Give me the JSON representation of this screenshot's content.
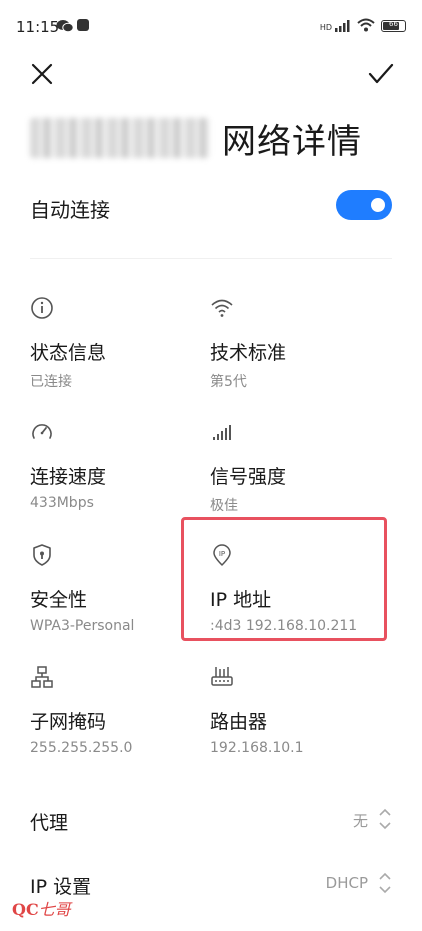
{
  "status_bar": {
    "time": "11:15",
    "network_label": "HD",
    "battery_label": "66"
  },
  "header": {
    "title": "网络详情"
  },
  "auto_connect": {
    "label": "自动连接",
    "enabled": true
  },
  "details": [
    {
      "label": "状态信息",
      "value": "已连接",
      "icon": "info-icon"
    },
    {
      "label": "技术标准",
      "value": "第5代",
      "icon": "wifi-icon"
    },
    {
      "label": "连接速度",
      "value": "433Mbps",
      "icon": "speedometer-icon"
    },
    {
      "label": "信号强度",
      "value": "极佳",
      "icon": "signal-bars-icon"
    },
    {
      "label": "安全性",
      "value": "WPA3-Personal",
      "icon": "shield-lock-icon"
    },
    {
      "label": "IP 地址",
      "value": ":4d3 192.168.10.211",
      "icon": "ip-pin-icon"
    },
    {
      "label": "子网掩码",
      "value": "255.255.255.0",
      "icon": "network-tree-icon"
    },
    {
      "label": "路由器",
      "value": "192.168.10.1",
      "icon": "router-icon"
    }
  ],
  "settings": [
    {
      "label": "代理",
      "value": "无"
    },
    {
      "label": "IP 设置",
      "value": "DHCP"
    }
  ],
  "watermark": {
    "latin": "QC",
    "chinese": "七哥"
  },
  "colors": {
    "accent": "#1f7dff",
    "highlight_border": "#e8515f",
    "watermark": "#e04646"
  }
}
